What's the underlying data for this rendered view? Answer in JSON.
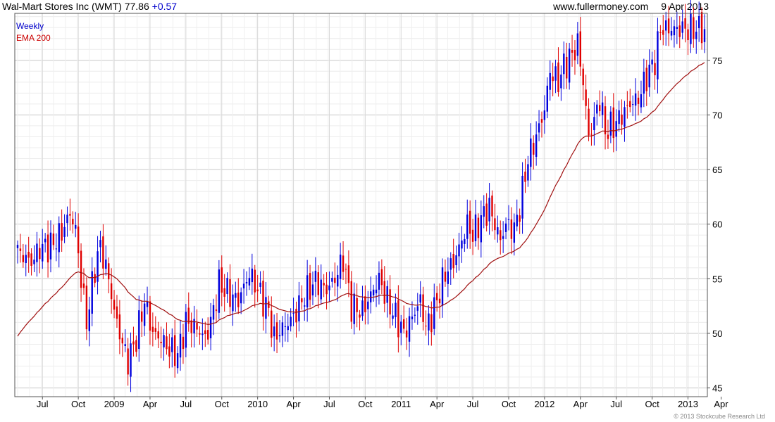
{
  "header": {
    "title": "Wal-Mart Stores Inc (WMT) 77.86",
    "change": "+0.57",
    "source": "www.fullermoney.com",
    "date": "9 Apr 2013"
  },
  "footer": {
    "copyright": "© 2013 Stockcube Research Ltd"
  },
  "colors": {
    "up": "#0000dd",
    "down": "#e00000",
    "ema": "#a01010",
    "grid": "#dcdcdc",
    "legend_weekly": "#0000cc",
    "legend_ema": "#cc0000"
  },
  "chart_data": {
    "type": "candlestick",
    "legend": [
      "Weekly",
      "EMA 200"
    ],
    "y_ticks": [
      45,
      50,
      55,
      60,
      65,
      70,
      75
    ],
    "ylim": [
      44.2,
      79.3
    ],
    "x_ticks": [
      "Jul",
      "Oct",
      "2009",
      "Apr",
      "Jul",
      "Oct",
      "2010",
      "Apr",
      "Jul",
      "Oct",
      "2011",
      "Apr",
      "Jul",
      "Oct",
      "2012",
      "Apr",
      "Jul",
      "Oct",
      "2013",
      "Apr"
    ],
    "weeks": 250,
    "week_ticks": [
      9,
      22,
      35,
      48,
      61,
      74,
      87,
      100,
      113,
      126,
      139,
      152,
      165,
      178,
      191,
      204,
      217,
      230,
      243,
      255
    ],
    "anchors": [
      [
        0,
        57.5
      ],
      [
        5,
        56.5
      ],
      [
        8,
        57.8
      ],
      [
        12,
        58.0
      ],
      [
        16,
        59.2
      ],
      [
        19,
        61.0
      ],
      [
        21,
        59.5
      ],
      [
        23,
        55.0
      ],
      [
        25,
        51.0
      ],
      [
        28,
        56.0
      ],
      [
        30,
        58.0
      ],
      [
        33,
        55.0
      ],
      [
        35,
        52.0
      ],
      [
        38,
        49.0
      ],
      [
        40,
        47.5
      ],
      [
        43,
        49.5
      ],
      [
        46,
        53.0
      ],
      [
        49,
        50.0
      ],
      [
        52,
        49.5
      ],
      [
        55,
        48.5
      ],
      [
        58,
        48.0
      ],
      [
        61,
        51.0
      ],
      [
        65,
        50.5
      ],
      [
        68,
        49.5
      ],
      [
        70,
        51.0
      ],
      [
        73,
        54.5
      ],
      [
        77,
        53.5
      ],
      [
        80,
        53.0
      ],
      [
        84,
        55.5
      ],
      [
        87,
        54.0
      ],
      [
        91,
        52.0
      ],
      [
        93,
        49.5
      ],
      [
        96,
        50.5
      ],
      [
        100,
        51.5
      ],
      [
        104,
        53.5
      ],
      [
        108,
        54.8
      ],
      [
        112,
        54.0
      ],
      [
        115,
        55.0
      ],
      [
        118,
        56.8
      ],
      [
        121,
        52.5
      ],
      [
        125,
        52.0
      ],
      [
        128,
        53.5
      ],
      [
        131,
        55.0
      ],
      [
        134,
        53.0
      ],
      [
        138,
        51.0
      ],
      [
        140,
        50.0
      ],
      [
        143,
        51.5
      ],
      [
        146,
        53.0
      ],
      [
        148,
        50.5
      ],
      [
        150,
        51.5
      ],
      [
        152,
        53.0
      ],
      [
        155,
        55.5
      ],
      [
        158,
        56.5
      ],
      [
        161,
        58.5
      ],
      [
        163,
        60.0
      ],
      [
        165,
        59.0
      ],
      [
        168,
        60.5
      ],
      [
        171,
        61.5
      ],
      [
        173,
        60.0
      ],
      [
        175,
        58.5
      ],
      [
        177,
        60.0
      ],
      [
        180,
        59.5
      ],
      [
        182,
        61.5
      ],
      [
        185,
        66.0
      ],
      [
        188,
        68.0
      ],
      [
        191,
        70.5
      ],
      [
        193,
        74.0
      ],
      [
        196,
        73.0
      ],
      [
        198,
        74.5
      ],
      [
        201,
        75.5
      ],
      [
        203,
        76.5
      ],
      [
        205,
        73.0
      ],
      [
        207,
        68.0
      ],
      [
        209,
        69.5
      ],
      [
        211,
        71.5
      ],
      [
        213,
        68.5
      ],
      [
        216,
        69.0
      ],
      [
        219,
        70.0
      ],
      [
        222,
        71.0
      ],
      [
        225,
        71.5
      ],
      [
        228,
        73.5
      ],
      [
        231,
        75.0
      ],
      [
        233,
        77.86
      ]
    ]
  }
}
